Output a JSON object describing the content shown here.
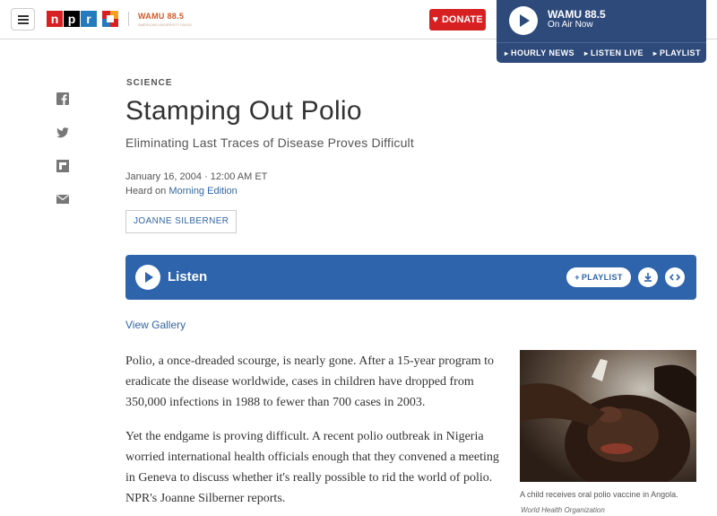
{
  "header": {
    "npr_letters": [
      "n",
      "p",
      "r"
    ],
    "station_logo": "WAMU 88.5",
    "station_logo_sub": "AMERICAN UNIVERSITY RADIO",
    "donate_label": "DONATE",
    "player": {
      "station": "WAMU 88.5",
      "status": "On Air Now",
      "links": [
        "HOURLY NEWS",
        "LISTEN LIVE",
        "PLAYLIST"
      ]
    }
  },
  "share": [
    "facebook-icon",
    "twitter-icon",
    "flipboard-icon",
    "email-icon"
  ],
  "article": {
    "section": "SCIENCE",
    "title": "Stamping Out Polio",
    "subtitle": "Eliminating Last Traces of Disease Proves Difficult",
    "date": "January 16, 2004 · 12:00 AM ET",
    "heard_prefix": "Heard on ",
    "heard_show": "Morning Edition",
    "byline": "JOANNE SILBERNER",
    "listen_label": "Listen",
    "playlist_label": "PLAYLIST",
    "gallery_link": "View Gallery",
    "paragraphs": [
      "Polio, a once-dreaded scourge, is nearly gone. After a 15-year program to eradicate the disease worldwide, cases in children have dropped from 350,000 infections in 1988 to fewer than 700 cases in 2003.",
      "Yet the endgame is proving difficult. A recent polio outbreak in Nigeria worried international health officials enough that they convened a meeting in Geneva to discuss whether it's really possible to rid the world of polio. NPR's Joanne Silberner reports."
    ],
    "image_caption": "A child receives oral polio vaccine in Angola.",
    "image_credit": "World Health Organization"
  },
  "colors": {
    "npr_red": "#d62021",
    "npr_blue": "#237bbd",
    "player_bg": "#2e4a7b",
    "listen_bg": "#2e64ac",
    "link": "#3366a4"
  }
}
